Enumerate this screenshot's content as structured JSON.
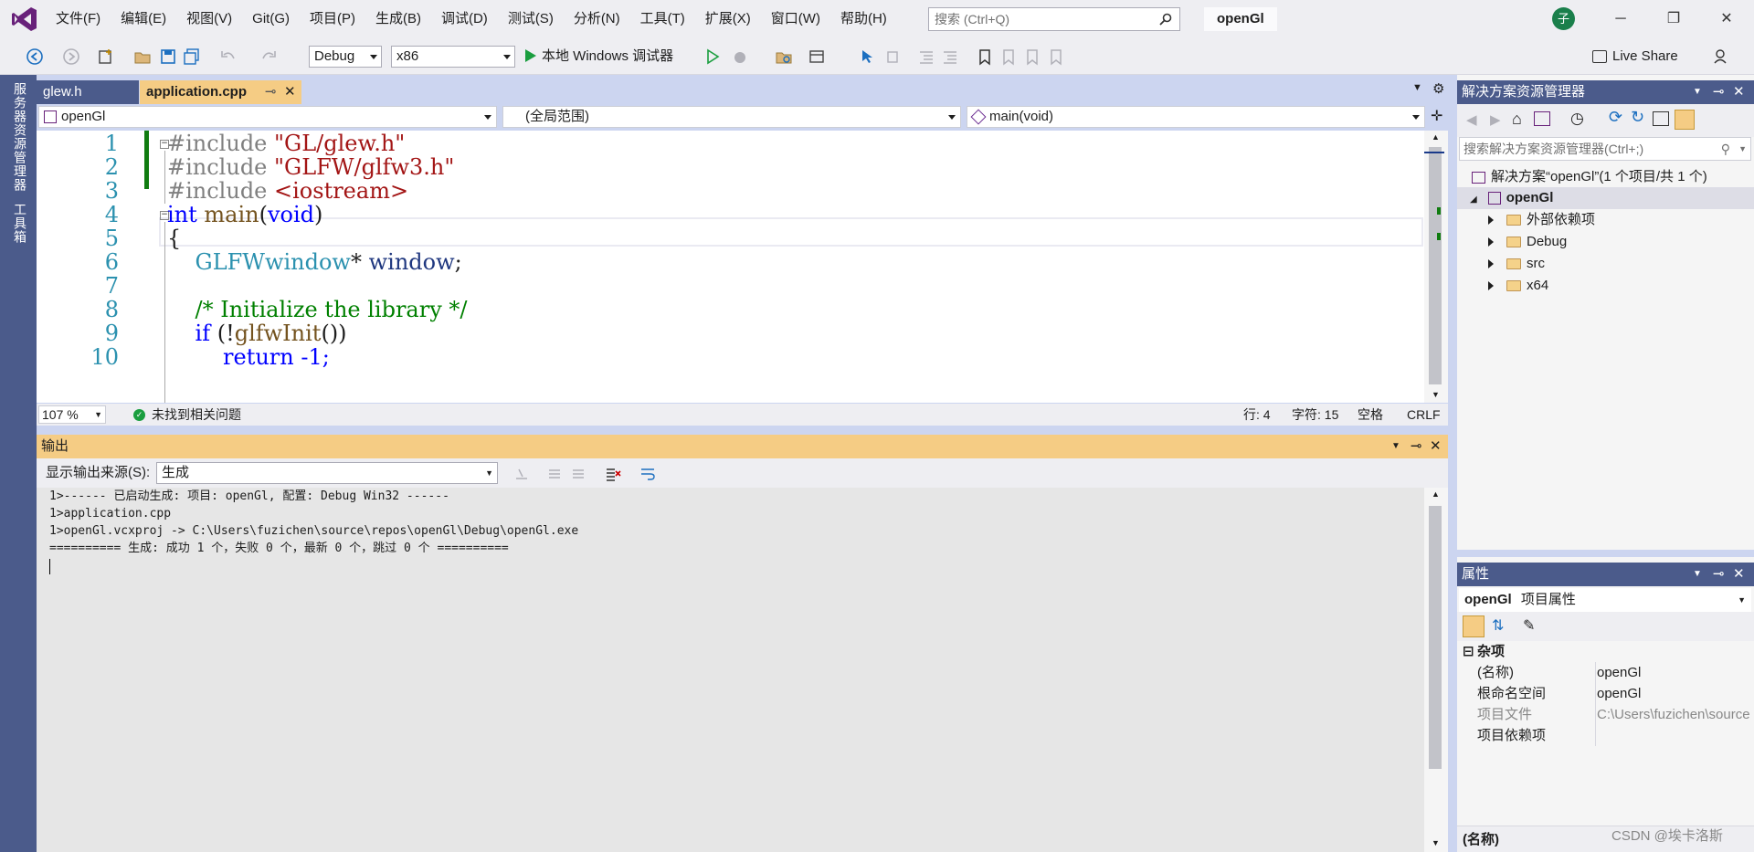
{
  "menu": [
    "文件(F)",
    "编辑(E)",
    "视图(V)",
    "Git(G)",
    "项目(P)",
    "生成(B)",
    "调试(D)",
    "测试(S)",
    "分析(N)",
    "工具(T)",
    "扩展(X)",
    "窗口(W)",
    "帮助(H)"
  ],
  "search": {
    "placeholder": "搜索 (Ctrl+Q)"
  },
  "solution_name": "openGl",
  "avatar": "子",
  "window_buttons": {
    "minimize": "─",
    "restore": "❐",
    "close": "✕"
  },
  "toolbar": {
    "config": "Debug",
    "platform": "x86",
    "run_label": "本地 Windows 调试器",
    "live_share": "Live Share"
  },
  "left_tabs": [
    "服务器资源管理器",
    "工具箱"
  ],
  "tabs": [
    {
      "label": "glew.h"
    },
    {
      "label": "application.cpp"
    }
  ],
  "nav": {
    "project": "openGl",
    "scope": "(全局范围)",
    "member": "main(void)"
  },
  "code_lines": [
    {
      "n": "1"
    },
    {
      "n": "2"
    },
    {
      "n": "3"
    },
    {
      "n": "4"
    },
    {
      "n": "5"
    },
    {
      "n": "6"
    },
    {
      "n": "7"
    },
    {
      "n": "8"
    },
    {
      "n": "9"
    },
    {
      "n": "10"
    }
  ],
  "code": {
    "l1a": "#include ",
    "l1b": "\"GL/glew.h\"",
    "l2a": "#include ",
    "l2b": "\"GLFW/glfw3.h\"",
    "l3a": "#include ",
    "l3b": "<iostream>",
    "l4a": "int ",
    "l4b": "main",
    "l4c": "(",
    "l4d": "void",
    "l4e": ")",
    "l5": "{",
    "l6a": "    GLFWwindow",
    "l6b": "* ",
    "l6c": "window",
    ";": ";",
    "l8": "    /* Initialize the library */",
    "l9a": "    if ",
    "l9b": "(!",
    "l9c": "glfwInit",
    "l9d": "())",
    "l10": "        return -1;"
  },
  "editor_status": {
    "zoom": "107 %",
    "issues": "未找到相关问题",
    "line": "行: 4",
    "char": "字符: 15",
    "ws": "空格",
    "eol": "CRLF"
  },
  "output": {
    "title": "输出",
    "source_label": "显示输出来源(S):",
    "source_value": "生成",
    "lines": [
      "1>------ 已启动生成: 项目: openGl, 配置: Debug Win32 ------",
      "1>application.cpp",
      "1>openGl.vcxproj -> C:\\Users\\fuzichen\\source\\repos\\openGl\\Debug\\openGl.exe",
      "========== 生成: 成功 1 个，失败 0 个，最新 0 个，跳过 0 个 =========="
    ]
  },
  "solution_explorer": {
    "title": "解决方案资源管理器",
    "search_placeholder": "搜索解决方案资源管理器(Ctrl+;)",
    "solution_line": "解决方案“openGl”(1 个项目/共 1 个)",
    "project": "openGl",
    "items": [
      "外部依赖项",
      "Debug",
      "src",
      "x64"
    ]
  },
  "properties": {
    "title": "属性",
    "object_name": "openGl",
    "object_type": "项目属性",
    "category": "杂项",
    "rows": [
      {
        "k": "(名称)",
        "v": "openGl"
      },
      {
        "k": "根命名空间",
        "v": "openGl"
      },
      {
        "k": "项目文件",
        "v": "C:\\Users\\fuzichen\\source"
      },
      {
        "k": "项目依赖项",
        "v": ""
      }
    ],
    "footer": "(名称)"
  },
  "watermark": "CSDN @埃卡洛斯",
  "colors": {
    "accent": "#4b5b8b",
    "tab_active": "#f5cc84",
    "keyword": "#0000ff",
    "string": "#a31515",
    "comment": "#008000",
    "type": "#2b91af"
  }
}
